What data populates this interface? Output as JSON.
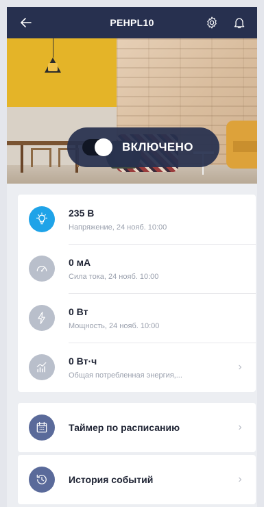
{
  "header": {
    "title": "PEHPL10"
  },
  "device": {
    "toggle_label": "ВКЛЮЧЕНО"
  },
  "metrics": [
    {
      "value": "235 В",
      "caption": "Напряжение, 24 нояб. 10:00"
    },
    {
      "value": "0 мА",
      "caption": "Сила тока, 24 нояб. 10:00"
    },
    {
      "value": "0 Вт",
      "caption": "Мощность, 24 нояб. 10:00"
    },
    {
      "value": "0 Вт·ч",
      "caption": "Общая потребленная энергия,..."
    }
  ],
  "menu": {
    "schedule": "Таймер по расписанию",
    "history": "История событий"
  },
  "colors": {
    "header": "#27304f",
    "accent_blue": "#1fa3e8",
    "icon_grey": "#b9bfcb",
    "icon_navy": "#5a6a9a"
  }
}
